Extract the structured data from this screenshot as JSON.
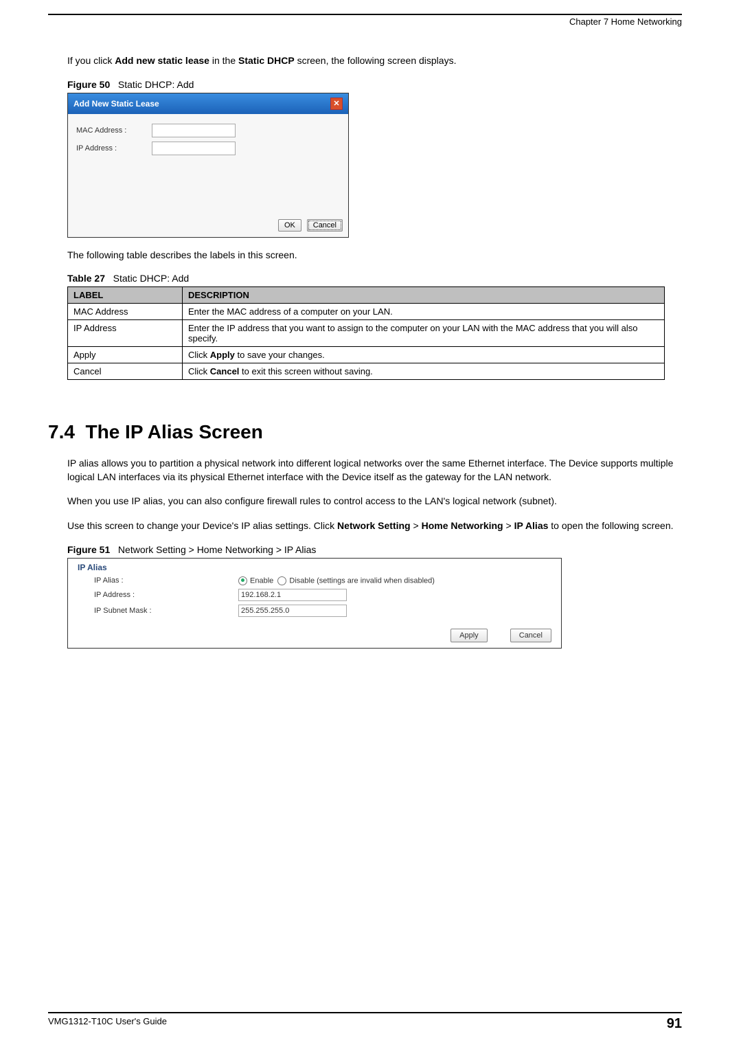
{
  "header": {
    "chapter": "Chapter 7 Home Networking"
  },
  "intro": {
    "prefix": "If you click ",
    "bold1": "Add new static lease",
    "mid": " in the ",
    "bold2": "Static DHCP",
    "suffix": " screen, the following screen displays."
  },
  "figure50": {
    "label": "Figure 50",
    "caption": "Static DHCP: Add",
    "dialog_title": "Add New Static Lease",
    "mac_label": "MAC Address :",
    "ip_label": "IP Address :",
    "ok": "OK",
    "cancel": "Cancel"
  },
  "table_intro": "The following table describes the labels in this screen.",
  "table27": {
    "label": "Table 27",
    "caption": "Static DHCP: Add",
    "headers": {
      "label": "LABEL",
      "desc": "DESCRIPTION"
    },
    "rows": [
      {
        "label": "MAC Address",
        "desc": "Enter the MAC address of a computer on your LAN."
      },
      {
        "label": "IP Address",
        "desc": "Enter the IP address that you want to assign to the computer on your LAN with the MAC address that you will also specify."
      },
      {
        "label": "Apply",
        "desc_prefix": "Click ",
        "desc_bold": "Apply",
        "desc_suffix": " to save your changes."
      },
      {
        "label": "Cancel",
        "desc_prefix": "Click ",
        "desc_bold": "Cancel",
        "desc_suffix": " to exit this screen without saving."
      }
    ]
  },
  "section": {
    "number": "7.4",
    "title": "The IP Alias Screen"
  },
  "para1": "IP alias allows you to partition a physical network into different logical networks over the same Ethernet interface. The Device supports multiple logical LAN interfaces via its physical Ethernet interface with the Device itself as the gateway for the LAN network.",
  "para2": "When you use IP alias, you can also configure firewall rules to control access to the LAN's logical network (subnet).",
  "para3": {
    "prefix": "Use this screen to change your Device's IP alias settings. Click ",
    "b1": "Network Setting",
    "sep1": " > ",
    "b2": "Home Networking",
    "sep2": " > ",
    "b3": "IP Alias",
    "suffix": " to open the following screen."
  },
  "figure51": {
    "label": "Figure 51",
    "caption": "Network Setting > Home Networking > IP Alias",
    "heading": "IP Alias",
    "alias_label": "IP Alias :",
    "enable": "Enable",
    "disable": "Disable (settings are invalid when disabled)",
    "ip_label": "IP Address :",
    "ip_value": "192.168.2.1",
    "mask_label": "IP Subnet Mask :",
    "mask_value": "255.255.255.0",
    "apply": "Apply",
    "cancel": "Cancel"
  },
  "footer": {
    "guide": "VMG1312-T10C User's Guide",
    "page": "91"
  }
}
